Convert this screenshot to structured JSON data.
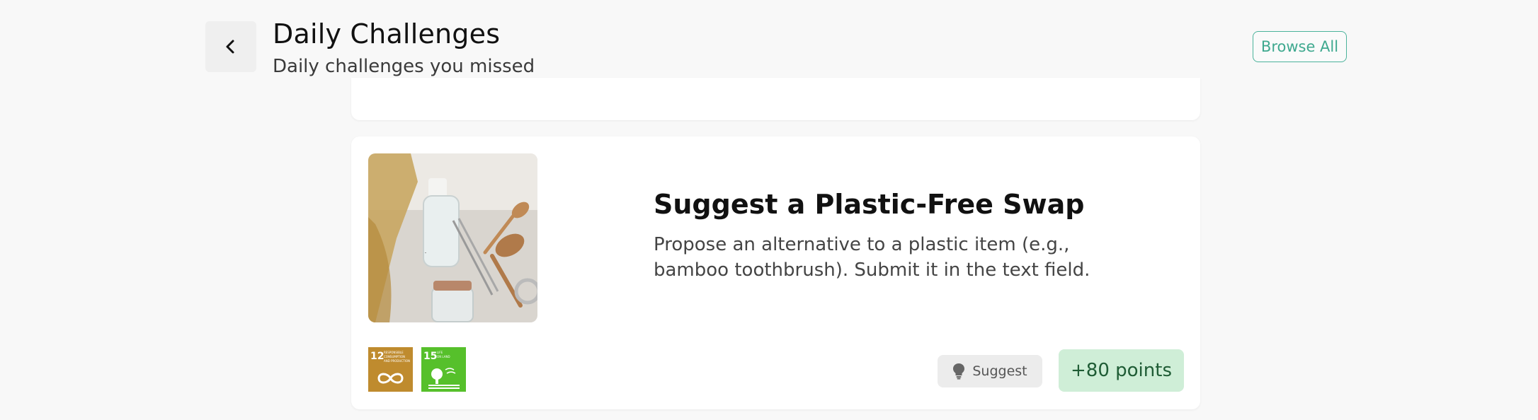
{
  "header": {
    "title": "Daily Challenges",
    "subtitle": "Daily challenges you missed",
    "browse_all_label": "Browse All",
    "back_icon": "chevron-left-icon"
  },
  "challenge": {
    "title": "Suggest a Plastic-Free Swap",
    "description": "Propose an alternative to a plastic item (e.g., bamboo toothbrush). Submit it in the text field.",
    "action_label": "Suggest",
    "action_icon": "lightbulb-icon",
    "points_label": "+80 points",
    "sdg_goals": [
      {
        "number": "12",
        "text": "RESPONSIBLE CONSUMPTION AND PRODUCTION",
        "color": "#bf8b2e"
      },
      {
        "number": "15",
        "text": "LIFE ON LAND",
        "color": "#56c02b"
      }
    ]
  },
  "colors": {
    "accent": "#3fa98f",
    "points_bg": "#cfeed7",
    "points_text": "#1f5c35",
    "background": "#f8f8f8"
  }
}
